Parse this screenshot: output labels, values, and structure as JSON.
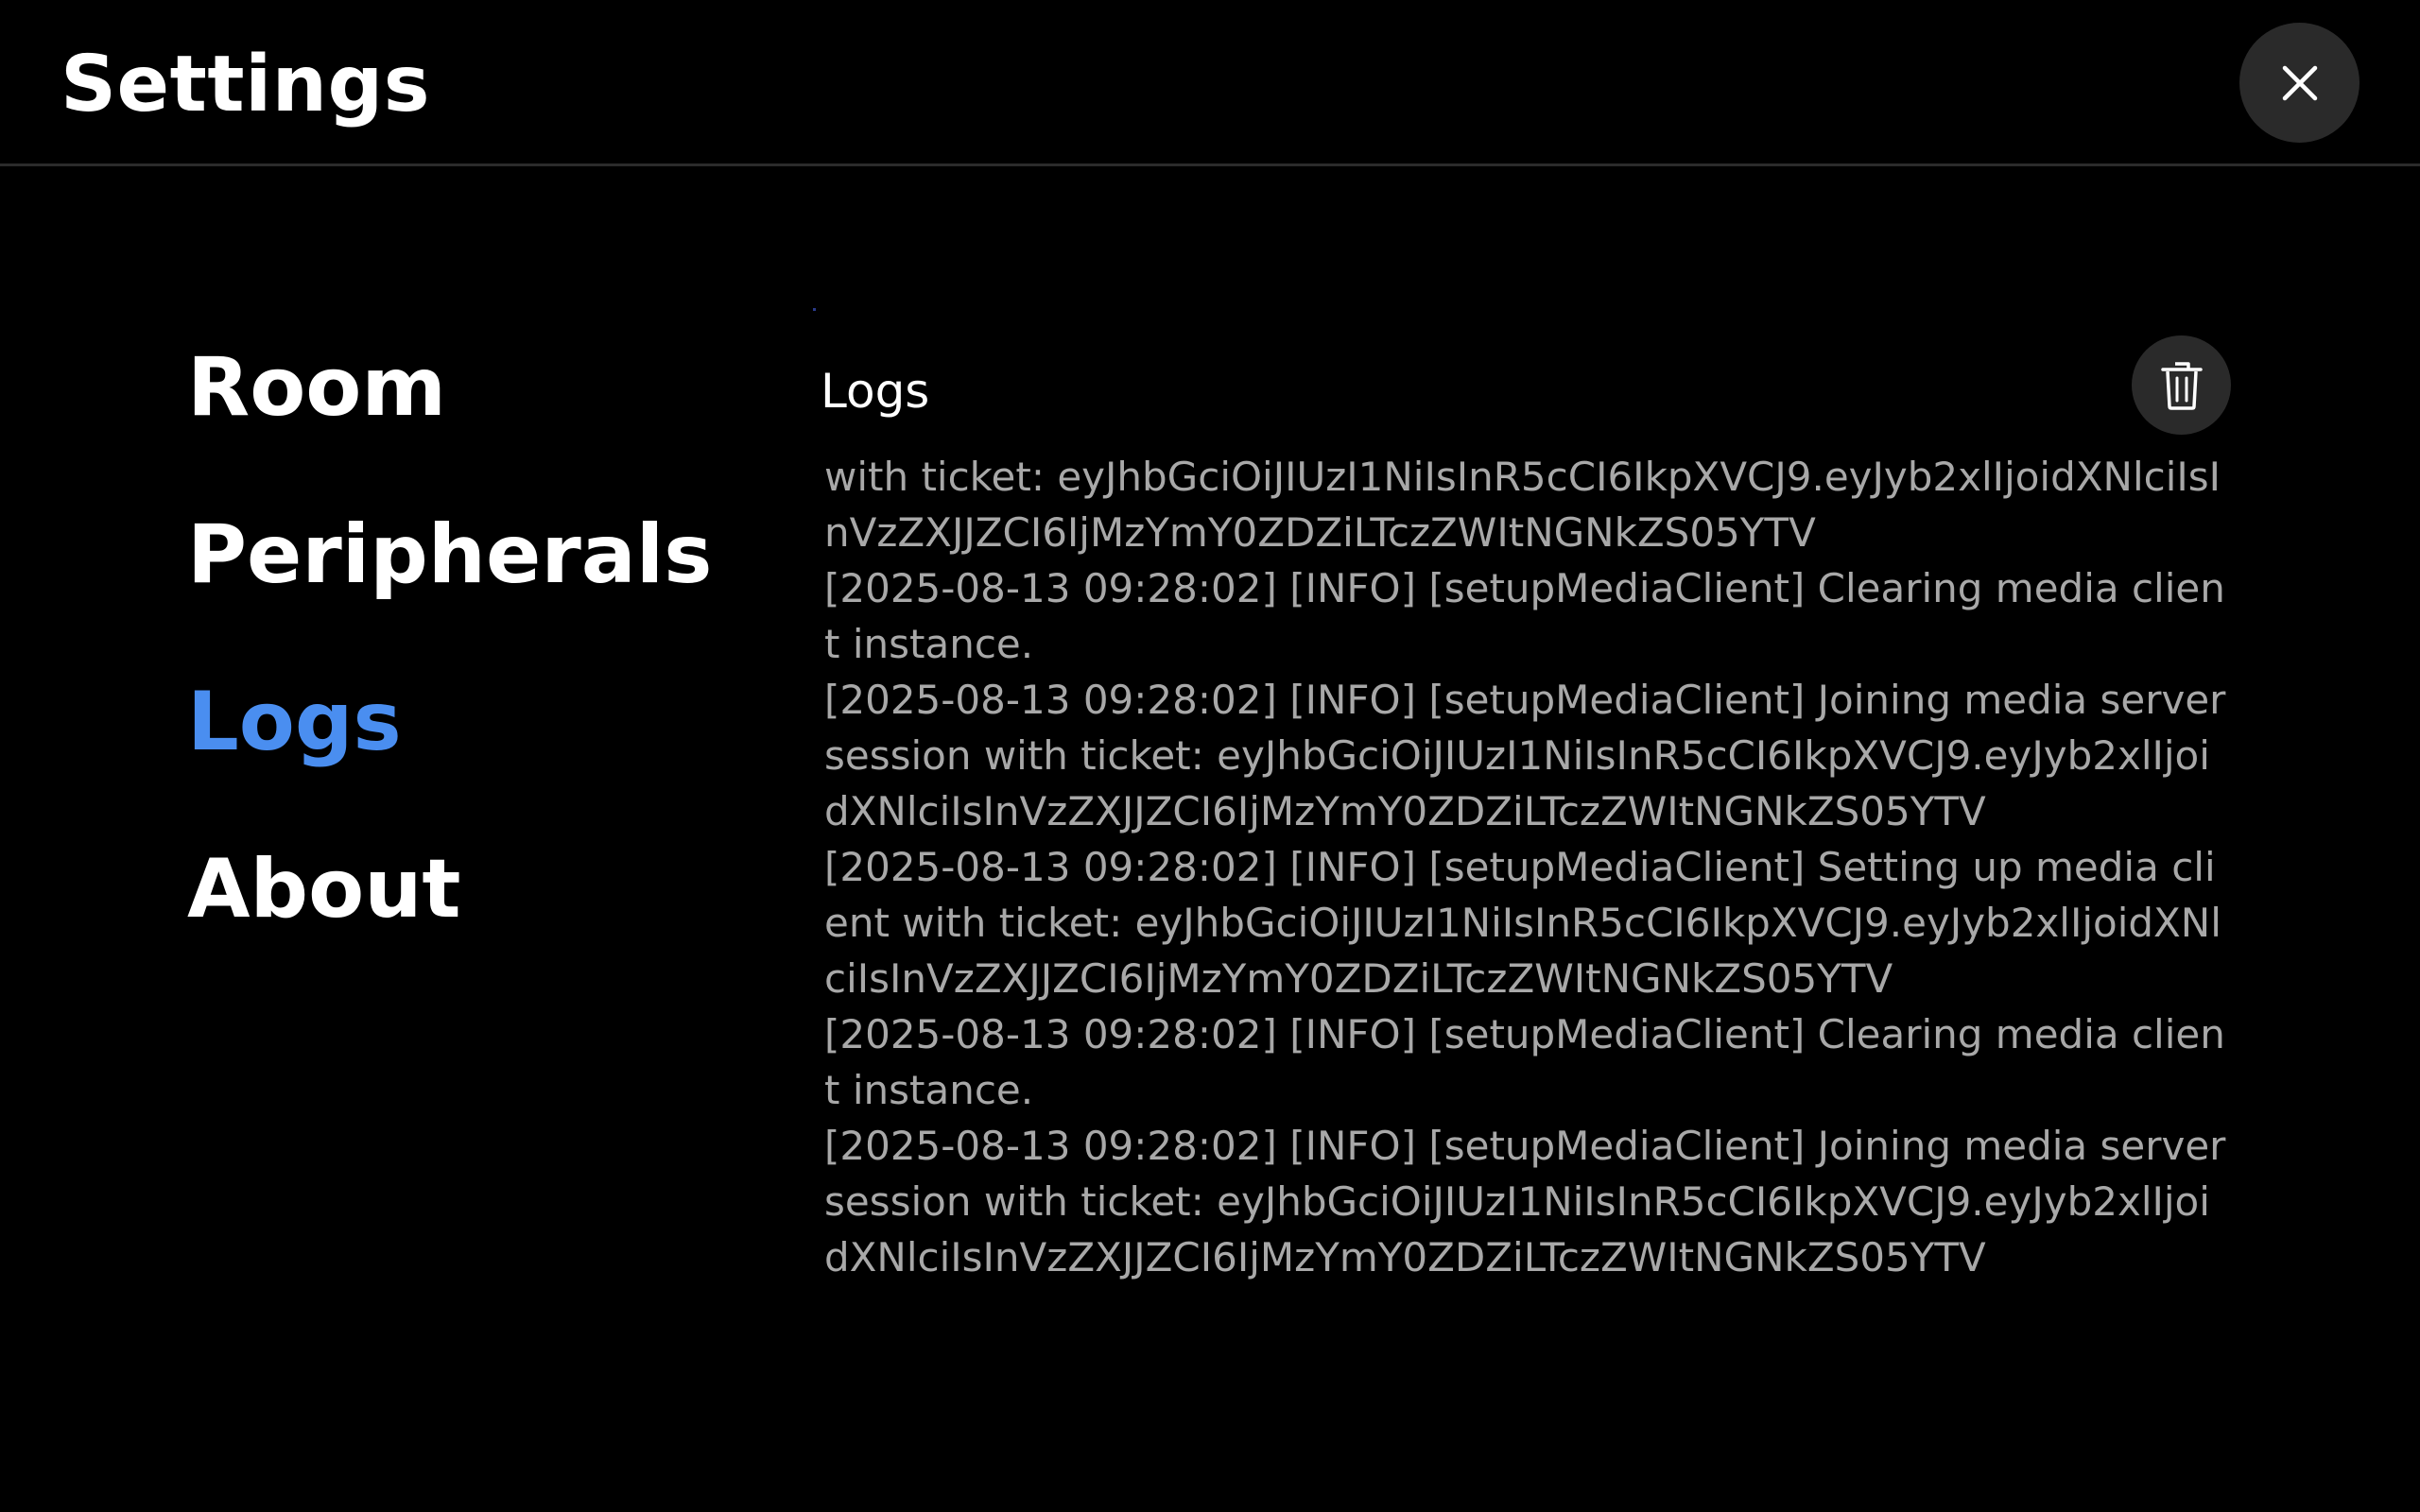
{
  "header": {
    "title": "Settings",
    "close_icon": "close-icon"
  },
  "sidebar": {
    "items": [
      {
        "label": "Room",
        "active": false
      },
      {
        "label": "Peripherals",
        "active": false
      },
      {
        "label": "Logs",
        "active": true
      },
      {
        "label": "About",
        "active": false
      }
    ]
  },
  "logs": {
    "title": "Logs",
    "clear_icon": "trash-icon",
    "entries": [
      "with ticket: eyJhbGciOiJIUzI1NiIsInR5cCI6IkpXVCJ9.eyJyb2xlIjoidXNlciIsInVzZXJJZCI6IjMzYmY0ZDZiLTczZWItNGNkZS05YTV",
      "[2025-08-13 09:28:02] [INFO] [setupMediaClient] Clearing media client instance.",
      "[2025-08-13 09:28:02] [INFO] [setupMediaClient] Joining media server session with ticket: eyJhbGciOiJIUzI1NiIsInR5cCI6IkpXVCJ9.eyJyb2xlIjoidXNlciIsInVzZXJJZCI6IjMzYmY0ZDZiLTczZWItNGNkZS05YTV",
      "[2025-08-13 09:28:02] [INFO] [setupMediaClient] Setting up media client with ticket: eyJhbGciOiJIUzI1NiIsInR5cCI6IkpXVCJ9.eyJyb2xlIjoidXNlciIsInVzZXJJZCI6IjMzYmY0ZDZiLTczZWItNGNkZS05YTV",
      "[2025-08-13 09:28:02] [INFO] [setupMediaClient] Clearing media client instance.",
      "[2025-08-13 09:28:02] [INFO] [setupMediaClient] Joining media server session with ticket: eyJhbGciOiJIUzI1NiIsInR5cCI6IkpXVCJ9.eyJyb2xlIjoidXNlciIsInVzZXJJZCI6IjMzYmY0ZDZiLTczZWItNGNkZS05YTV"
    ]
  },
  "colors": {
    "background": "#000000",
    "accent": "#4a8ef0",
    "log_text": "#a8a8a8",
    "button_bg": "#2a2a2a"
  }
}
